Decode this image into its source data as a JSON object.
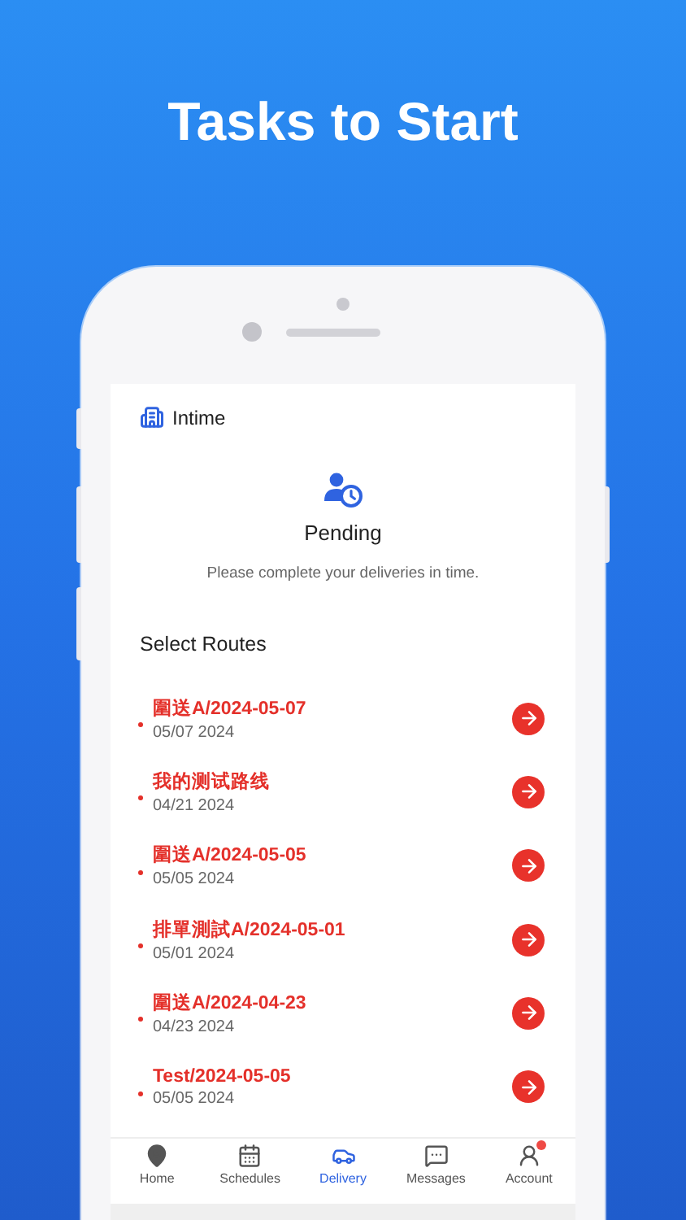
{
  "hero_title": "Tasks to Start",
  "app": {
    "company": "Intime"
  },
  "status": {
    "title": "Pending",
    "message": "Please complete your deliveries in time."
  },
  "routes_heading": "Select Routes",
  "routes": [
    {
      "name": "圍送A/2024-05-07",
      "date": "05/07 2024"
    },
    {
      "name": "我的测试路线",
      "date": "04/21 2024"
    },
    {
      "name": "圍送A/2024-05-05",
      "date": "05/05 2024"
    },
    {
      "name": "排單測試A/2024-05-01",
      "date": "05/01 2024"
    },
    {
      "name": "圍送A/2024-04-23",
      "date": "04/23 2024"
    },
    {
      "name": "Test/2024-05-05",
      "date": "05/05 2024"
    }
  ],
  "tab_bar": [
    {
      "kind": "home",
      "label": "Home",
      "selected": false,
      "badge": false
    },
    {
      "kind": "schedules",
      "label": "Schedules",
      "selected": false,
      "badge": false
    },
    {
      "kind": "delivery",
      "label": "Delivery",
      "selected": true,
      "badge": false
    },
    {
      "kind": "messages",
      "label": "Messages",
      "selected": false,
      "badge": false
    },
    {
      "kind": "account",
      "label": "Account",
      "selected": false,
      "badge": true
    }
  ]
}
